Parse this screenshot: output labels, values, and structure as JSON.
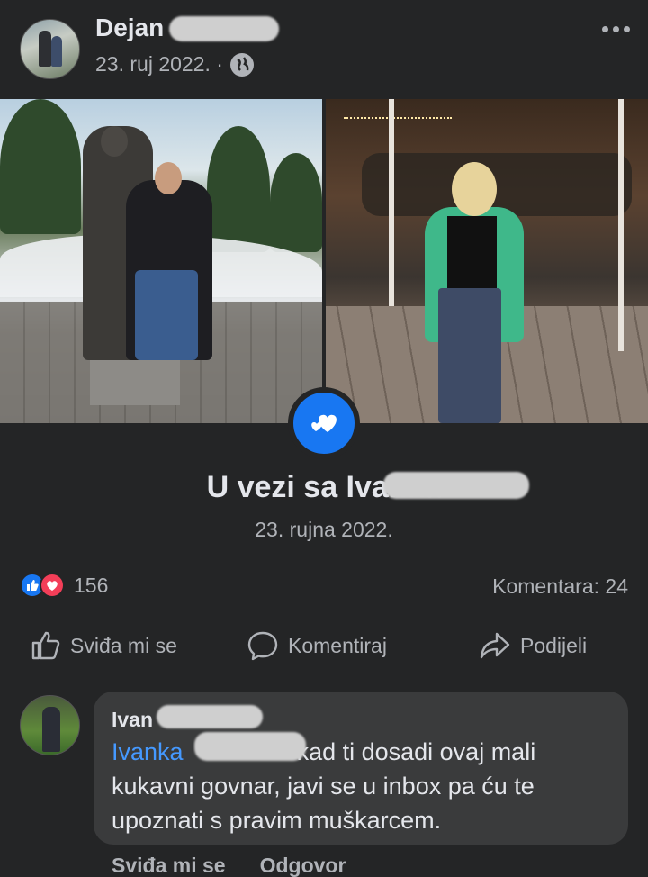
{
  "post": {
    "author": "Dejan",
    "date": "23. ruj 2022. ·",
    "privacy_icon": "globe-icon"
  },
  "life_event": {
    "icon": "hearts-icon",
    "title": "U vezi sa Ivanka",
    "date": "23. rujna 2022."
  },
  "stats": {
    "reaction_count": "156",
    "comments": "Komentara: 24"
  },
  "actions": {
    "like": "Sviđa mi se",
    "comment": "Komentiraj",
    "share": "Podijeli"
  },
  "comment": {
    "author": "Ivan",
    "mention": "Ivanka",
    "text_line1": "kad ti dosadi ovaj mali",
    "text_line2": "kukavni govnar, javi se u inbox pa ću te",
    "text_line3": "upoznati s pravim muškarcem.",
    "like": "Sviđa mi se",
    "reply": "Odgovor"
  },
  "colors": {
    "background": "#242526",
    "accent": "#1877f2",
    "love": "#f33e58",
    "mention": "#4599ff",
    "bubble": "#3a3b3c"
  }
}
